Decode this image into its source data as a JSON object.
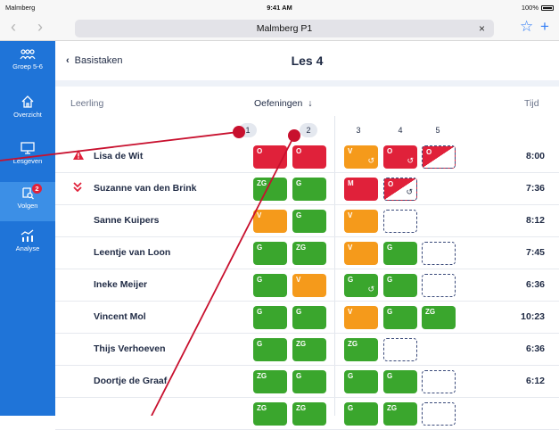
{
  "status": {
    "carrier": "Malmberg",
    "time": "9:41 AM",
    "battery": "100%"
  },
  "browser": {
    "url": "Malmberg P1",
    "clear_icon": "×"
  },
  "sidebar": [
    {
      "label": "Groep 5-6",
      "icon": "group-icon"
    },
    {
      "label": "Overzicht",
      "icon": "home-icon"
    },
    {
      "label": "Lesgeven",
      "icon": "screen-icon"
    },
    {
      "label": "Volgen",
      "icon": "follow-icon",
      "badge": "2",
      "active": true
    },
    {
      "label": "Analyse",
      "icon": "chart-icon"
    }
  ],
  "header": {
    "back_label": "Basistaken",
    "title": "Les 4"
  },
  "columns": {
    "student": "Leerling",
    "exercises": "Oefeningen",
    "time": "Tijd"
  },
  "exercise_numbers": [
    "1",
    "2",
    "3",
    "4",
    "5"
  ],
  "students": [
    {
      "name": "Lisa de Wit",
      "time": "8:00",
      "flag": "warning",
      "cells": [
        {
          "s": "red",
          "t": "O"
        },
        {
          "s": "red",
          "t": "O"
        },
        {
          "s": "orange",
          "t": "V",
          "lock": true
        },
        {
          "s": "red",
          "t": "O",
          "lock": true
        },
        {
          "s": "split",
          "t": "O"
        }
      ]
    },
    {
      "name": "Suzanne van den Brink",
      "time": "7:36",
      "flag": "down",
      "cells": [
        {
          "s": "green",
          "t": "ZG"
        },
        {
          "s": "green",
          "t": "G"
        },
        {
          "s": "red",
          "t": "M"
        },
        {
          "s": "split",
          "t": "O",
          "lock": true
        },
        null
      ]
    },
    {
      "name": "Sanne Kuipers",
      "time": "8:12",
      "cells": [
        {
          "s": "orange",
          "t": "V"
        },
        {
          "s": "green",
          "t": "G"
        },
        {
          "s": "orange",
          "t": "V"
        },
        {
          "s": "empty",
          "t": ""
        },
        null
      ]
    },
    {
      "name": "Leentje van Loon",
      "time": "7:45",
      "cells": [
        {
          "s": "green",
          "t": "G"
        },
        {
          "s": "green",
          "t": "ZG"
        },
        {
          "s": "orange",
          "t": "V"
        },
        {
          "s": "green",
          "t": "G"
        },
        {
          "s": "empty",
          "t": ""
        }
      ]
    },
    {
      "name": "Ineke Meijer",
      "time": "6:36",
      "cells": [
        {
          "s": "green",
          "t": "G"
        },
        {
          "s": "orange",
          "t": "V"
        },
        {
          "s": "green",
          "t": "G",
          "lock": true
        },
        {
          "s": "green",
          "t": "G"
        },
        {
          "s": "empty",
          "t": ""
        }
      ]
    },
    {
      "name": "Vincent Mol",
      "time": "10:23",
      "cells": [
        {
          "s": "green",
          "t": "G"
        },
        {
          "s": "green",
          "t": "G"
        },
        {
          "s": "orange",
          "t": "V"
        },
        {
          "s": "green",
          "t": "G"
        },
        {
          "s": "green",
          "t": "ZG"
        }
      ]
    },
    {
      "name": "Thijs Verhoeven",
      "time": "6:36",
      "cells": [
        {
          "s": "green",
          "t": "G"
        },
        {
          "s": "green",
          "t": "ZG"
        },
        {
          "s": "green",
          "t": "ZG"
        },
        {
          "s": "empty",
          "t": ""
        },
        null
      ]
    },
    {
      "name": "Doortje de Graaf",
      "time": "6:12",
      "cells": [
        {
          "s": "green",
          "t": "ZG"
        },
        {
          "s": "green",
          "t": "G"
        },
        {
          "s": "green",
          "t": "G"
        },
        {
          "s": "green",
          "t": "G"
        },
        {
          "s": "empty",
          "t": ""
        }
      ]
    },
    {
      "name": "",
      "time": "",
      "cells": [
        {
          "s": "green",
          "t": "ZG"
        },
        {
          "s": "green",
          "t": "ZG"
        },
        {
          "s": "green",
          "t": "G"
        },
        {
          "s": "green",
          "t": "ZG"
        },
        {
          "s": "empty",
          "t": ""
        }
      ]
    }
  ],
  "colors": {
    "sidebar": "#1f74d8",
    "green": "#3aa62d",
    "orange": "#f59a1b",
    "red": "#e0213a",
    "annotation": "#c8102e"
  }
}
